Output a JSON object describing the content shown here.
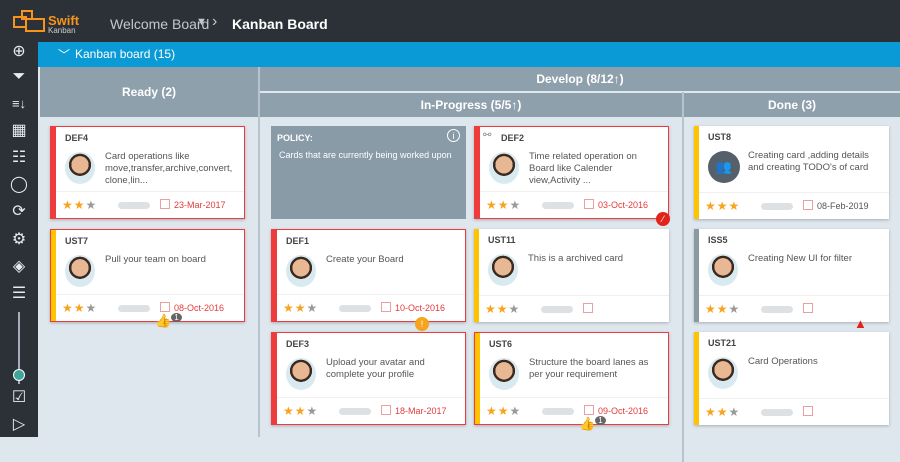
{
  "app": {
    "brand_name": "Swift",
    "brand_sub": "Kanban"
  },
  "breadcrumb": {
    "board": "Welcome Board",
    "page": "Kanban Board"
  },
  "board": {
    "title": "Kanban board (15)"
  },
  "columns": {
    "ready": "Ready (2)",
    "develop": "Develop (8/12↑)",
    "in_progress": "In-Progress (5/5↑)",
    "done": "Done (3)"
  },
  "policy": {
    "label": "POLICY:",
    "text": "Cards that are currently being worked upon"
  },
  "colors": {
    "red": "#ee3b3b",
    "yellow": "#ffc400",
    "gray": "#8a9a9e",
    "accent": "#0a9ad6"
  },
  "cards": [
    {
      "col": 0,
      "row": 0,
      "id": "DEF4",
      "text": "Card operations like move,transfer,archive,convert, clone,lin...",
      "stars": 2,
      "date": "23-Mar-2017",
      "overdue": true,
      "red": true,
      "stripe": "red"
    },
    {
      "col": 0,
      "row": 1,
      "id": "UST7",
      "text": "Pull your team on board",
      "stars": 2,
      "date": "08-Oct-2016",
      "overdue": true,
      "red": true,
      "stripe": "yellow",
      "badge": "like",
      "badge_count": "1"
    },
    {
      "col": 2,
      "row": 0,
      "id": "DEF2",
      "text": "Time related operation on Board like Calender view,Activity ...",
      "stars": 2,
      "date": "03-Oct-2016",
      "overdue": true,
      "red": true,
      "stripe": "red",
      "badge": "blocked",
      "linked": true
    },
    {
      "col": 1,
      "row": 1,
      "id": "DEF1",
      "text": "Create your Board",
      "stars": 2,
      "date": "10-Oct-2016",
      "overdue": true,
      "red": true,
      "stripe": "red",
      "badge": "alert"
    },
    {
      "col": 2,
      "row": 1,
      "id": "UST11",
      "text": "This is a archived card",
      "stars": 2,
      "date": "",
      "stripe": "yellow"
    },
    {
      "col": 1,
      "row": 2,
      "id": "DEF3",
      "text": "Upload your avatar and complete your profile",
      "stars": 2,
      "date": "18-Mar-2017",
      "overdue": true,
      "red": true,
      "stripe": "red"
    },
    {
      "col": 2,
      "row": 2,
      "id": "UST6",
      "text": "Structure the board lanes as per your requirement",
      "stars": 2,
      "date": "09-Oct-2016",
      "overdue": true,
      "red": true,
      "stripe": "yellow",
      "badge": "like",
      "badge_count": "1"
    },
    {
      "col": 3,
      "row": 0,
      "id": "UST8",
      "text": "Creating card ,adding details and creating TODO's of card",
      "stars": 3,
      "date": "08-Feb-2019",
      "stripe": "yellow",
      "group": true
    },
    {
      "col": 3,
      "row": 1,
      "id": "ISS5",
      "text": "Creating New UI for filter",
      "stars": 2,
      "date": "",
      "stripe": "gray",
      "badge": "warning"
    },
    {
      "col": 3,
      "row": 2,
      "id": "UST21",
      "text": "Card Operations",
      "stars": 2,
      "date": "",
      "stripe": "yellow"
    }
  ]
}
